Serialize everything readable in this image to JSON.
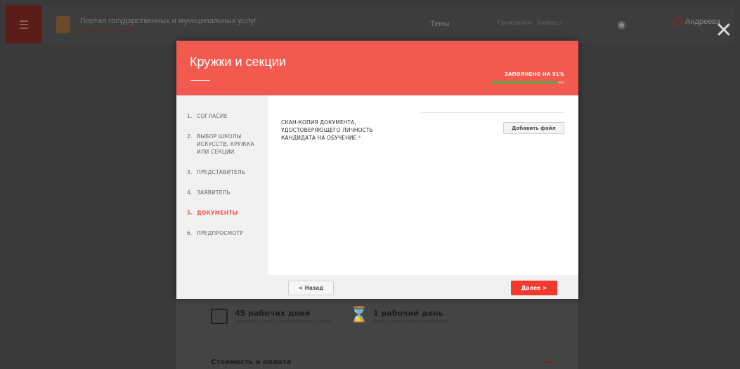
{
  "background": {
    "portal_title": "Портал государственных и муниципальных услуг",
    "portal_subtitle": "Московской области",
    "nav_topics": "Темы",
    "tab_citizens": "Гражданам",
    "tab_business": "Бизнесу",
    "user_name": "Андреева",
    "stat_days_value": "45 рабочих дней",
    "stat_days_label": "Максимальный срок оказания услуги",
    "stat_reg_value": "1 рабочий день",
    "stat_reg_label": "Срок регистрации заявления",
    "cost_title": "Стоимость и оплата"
  },
  "modal": {
    "title": "Кружки и секции",
    "progress_label": "ЗАПОЛНЕНО НА 91%",
    "progress_value": 91,
    "colors": {
      "accent": "#f25a50",
      "progress": "#4caf50"
    }
  },
  "steps": [
    {
      "num": "1.",
      "label": "СОГЛАСИЕ",
      "active": false
    },
    {
      "num": "2.",
      "label": "ВЫБОР ШКОЛЫ ИСКУССТВ, КРУЖКА ИЛИ СЕКЦИИ",
      "active": false
    },
    {
      "num": "3.",
      "label": "ПРЕДСТАВИТЕЛЬ",
      "active": false
    },
    {
      "num": "4.",
      "label": "ЗАЯВИТЕЛЬ",
      "active": false
    },
    {
      "num": "5.",
      "label": "ДОКУМЕНТЫ",
      "active": true
    },
    {
      "num": "6.",
      "label": "ПРЕДПРОСМОТР",
      "active": false
    }
  ],
  "documents": {
    "field_label": "СКАН-КОПИЯ ДОКУМЕНТА, УДОСТОВЕРЯЮЩЕГО ЛИЧНОСТЬ КАНДИДАТА НА ОБУЧЕНИЕ",
    "required_mark": "*",
    "add_file_label": "Добавить файл"
  },
  "footer": {
    "back_label": "< Назад",
    "next_label": "Далее >"
  }
}
